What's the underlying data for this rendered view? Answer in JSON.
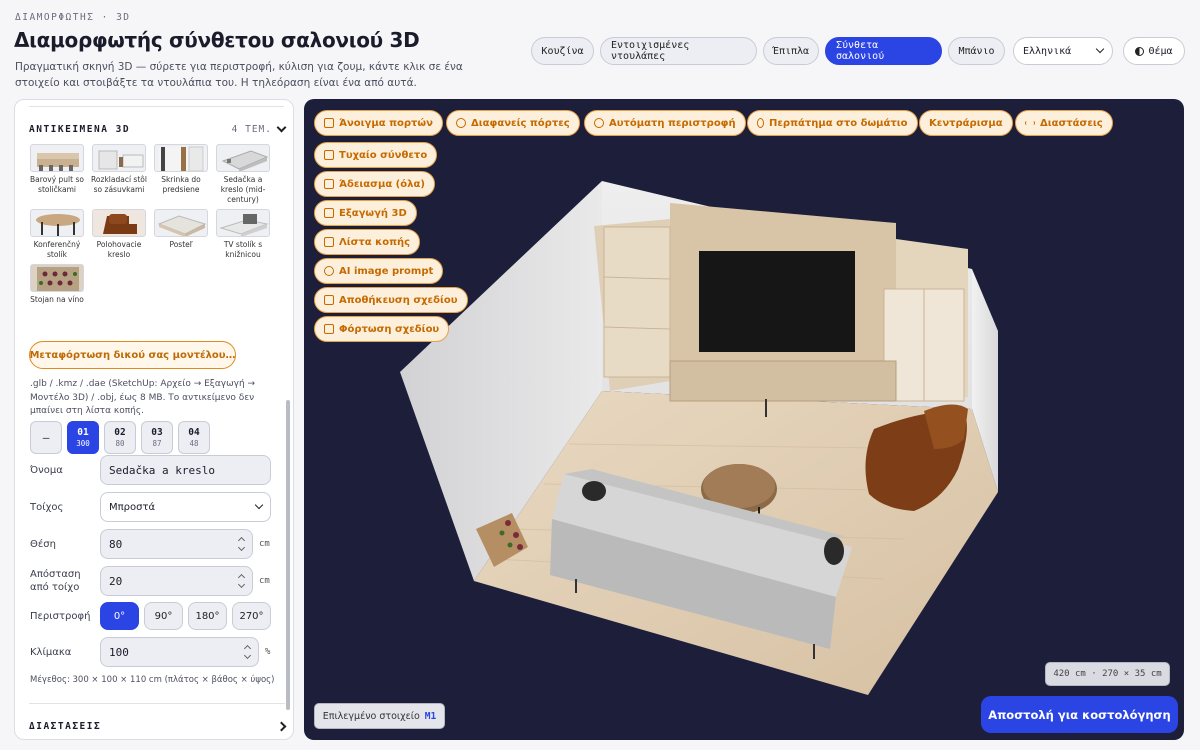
{
  "header": {
    "eyebrow": "ΔΙΑΜΟΡΦΩΤΗΣ · 3D",
    "title": "Διαμορφωτής σύνθετου σαλονιού 3D",
    "subtitle": "Πραγματική σκηνή 3D — σύρετε για περιστροφή, κύλιση για ζουμ, κάντε κλικ σε ένα στοιχείο και στοιβάξτε τα ντουλάπια του. Η τηλεόραση είναι ένα από αυτά."
  },
  "nav": {
    "tabs": [
      "Κουζίνα",
      "Εντοιχισμένες ντουλάπες",
      "Έπιπλα",
      "Σύνθετα σαλονιού",
      "Μπάνιο"
    ],
    "active_tab": "Σύνθετα σαλονιού",
    "language": "Ελληνικά",
    "theme_label": "Θέμα"
  },
  "objects_section": {
    "title": "ΑΝΤΙΚΕΙΜΕΝΑ 3D",
    "count": "4 ΤΕΜ.",
    "items": [
      {
        "label": "Barový pult so stoličkami",
        "icon": "bar-counter-thumb"
      },
      {
        "label": "Rozkladací stôl so zásuvkami",
        "icon": "folding-table-thumb"
      },
      {
        "label": "Skrinka do predsiene",
        "icon": "hall-cabinet-thumb"
      },
      {
        "label": "Sedačka a kreslo (mid-century)",
        "icon": "sofa-thumb"
      },
      {
        "label": "Konferenčný stolík",
        "icon": "coffee-table-thumb"
      },
      {
        "label": "Polohovacie kreslo",
        "icon": "recliner-thumb"
      },
      {
        "label": "Posteľ",
        "icon": "bed-thumb"
      },
      {
        "label": "TV stolík s knižnicou",
        "icon": "tv-stand-thumb"
      },
      {
        "label": "Stojan na víno",
        "icon": "wine-rack-thumb"
      }
    ],
    "upload_button": "Μεταφόρτωση δικού σας μοντέλου…",
    "upload_note": ".glb / .kmz / .dae (SketchUp: Αρχείο → Εξαγωγή → Μοντέλο 3D) / .obj, έως 8 MB. Το αντικείμενο δεν μπαίνει στη λίστα κοπής."
  },
  "unit_tabs": [
    {
      "num": "—",
      "sub": ""
    },
    {
      "num": "01",
      "sub": "300"
    },
    {
      "num": "02",
      "sub": "80"
    },
    {
      "num": "03",
      "sub": "87"
    },
    {
      "num": "04",
      "sub": "48"
    }
  ],
  "form": {
    "name_label": "Όνομα",
    "name_value": "Sedačka a kreslo",
    "wall_label": "Τοίχος",
    "wall_value": "Μπροστά",
    "position_label": "Θέση",
    "position_value": "80",
    "position_unit": "cm",
    "distance_label": "Απόσταση από τοίχο",
    "distance_value": "20",
    "distance_unit": "cm",
    "rotation_label": "Περιστροφή",
    "rotation_options": [
      "0°",
      "90°",
      "180°",
      "270°"
    ],
    "rotation_selected": "0°",
    "scale_label": "Κλίμακα",
    "scale_value": "100",
    "scale_unit": "%",
    "size_note": "Μέγεθος: 300 × 100 × 110 cm (πλάτος × βάθος × ύψος)"
  },
  "dimensions_section": {
    "title": "ΔΙΑΣΤΑΣΕΙΣ"
  },
  "toolbar": {
    "open_doors": "Άνοιγμα πορτών",
    "transparent_doors": "Διαφανείς πόρτες",
    "auto_rotate": "Αυτόματη περιστροφή",
    "walk": "Περπάτημα στο δωμάτιο",
    "center": "Κεντράρισμα",
    "dimensions": "Διαστάσεις",
    "random": "Τυχαίο σύνθετο",
    "empty": "Άδειασμα (όλα)",
    "export": "Εξαγωγή 3D",
    "cut_list": "Λίστα κοπής",
    "ai_prompt": "AI image prompt",
    "save": "Αποθήκευση σχεδίου",
    "load": "Φόρτωση σχεδίου"
  },
  "viewport": {
    "room_dims": "420 cm · 270 × 35 cm",
    "selected_label": "Επιλεγμένο στοιχείο",
    "selected_value": "M1",
    "send_button": "Αποστολή για κοστολόγηση"
  },
  "colors": {
    "accent": "#2b44e4",
    "tool_orange": "#c66a00",
    "viewport_bg": "#1c1e3a"
  }
}
